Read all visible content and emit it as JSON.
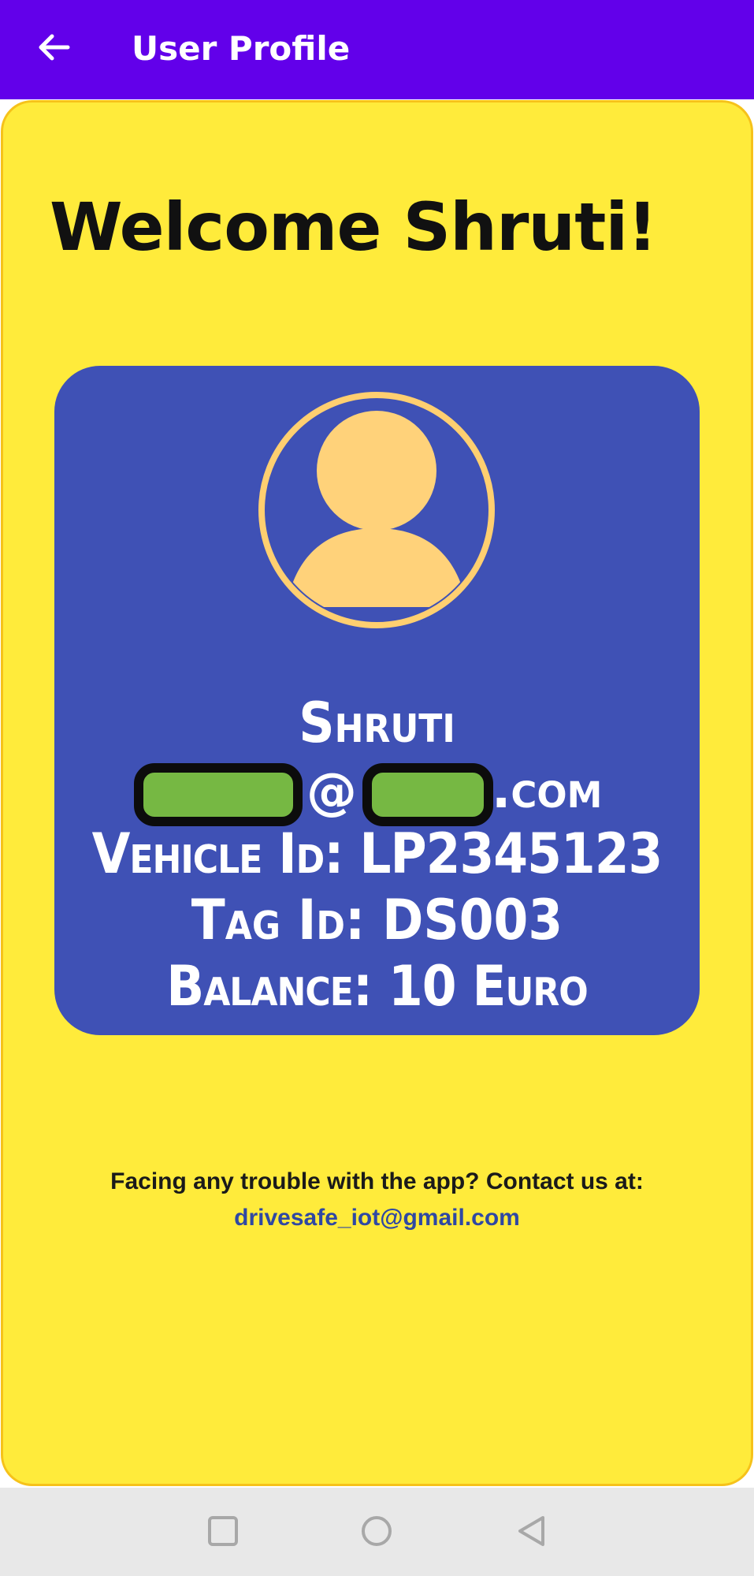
{
  "app_bar": {
    "title": "User Profile",
    "back_icon": "arrow-left-icon",
    "background_color": "#6200ea"
  },
  "main": {
    "welcome_text": "Welcome Shruti!",
    "panel_color": "#ffeb3b"
  },
  "profile_card": {
    "card_color": "#3f51b5",
    "avatar_icon": "user-avatar-icon",
    "avatar_color": "#ffd27a",
    "name": "Shruti",
    "email_at": "@",
    "email_tld": ".com",
    "redaction_color": "#76b843",
    "vehicle_id": "Vehicle Id: LP2345123",
    "tag_id": "Tag Id: DS003",
    "balance": "Balance: 10 Euro"
  },
  "support": {
    "text": "Facing any trouble with the app? Contact us at:",
    "email": "drivesafe_iot@gmail.com"
  },
  "system_nav": {
    "recents_icon": "square-recents-icon",
    "home_icon": "circle-home-icon",
    "back_icon": "triangle-back-icon"
  }
}
